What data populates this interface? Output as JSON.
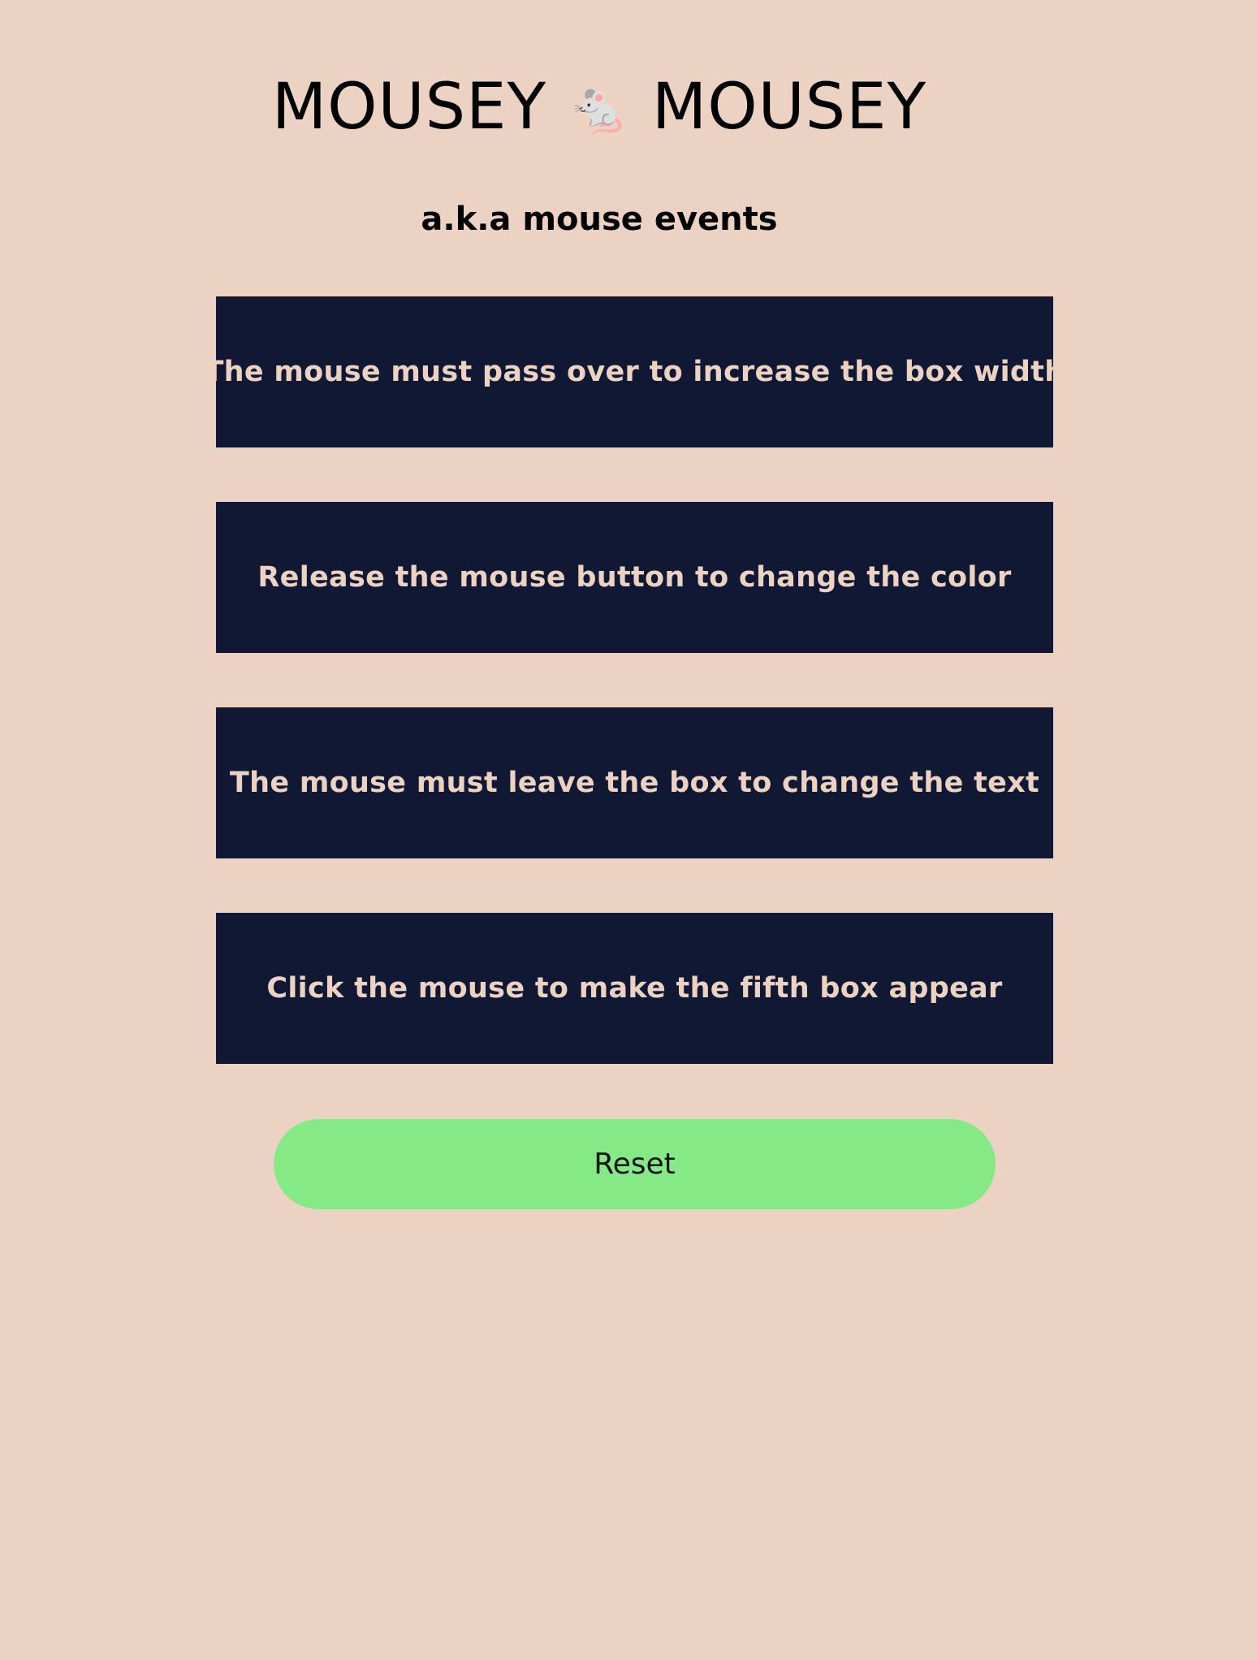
{
  "header": {
    "title_left": "MOUSEY",
    "title_emoji": "🐁",
    "title_right": "MOUSEY",
    "subtitle": "a.k.a mouse events"
  },
  "boxes": [
    {
      "label": "The mouse must pass over to increase the box width"
    },
    {
      "label": "Release the mouse button to change the color"
    },
    {
      "label": "The mouse must leave the box to change the text"
    },
    {
      "label": "Click the mouse to make the fifth box appear"
    }
  ],
  "reset": {
    "label": "Reset"
  },
  "colors": {
    "background": "#ecd2c2",
    "box_background": "#111834",
    "box_text": "#ecd2c2",
    "reset_background": "#85e985"
  }
}
